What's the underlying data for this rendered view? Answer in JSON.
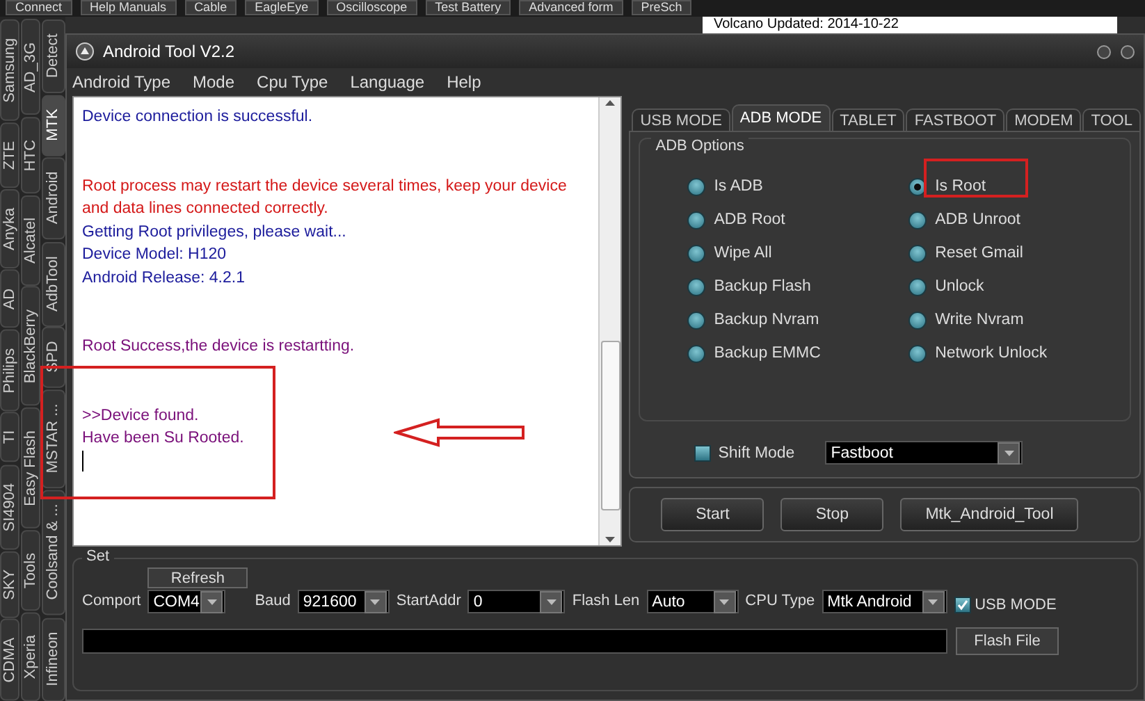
{
  "top_toolbar": {
    "buttons": [
      "Connect",
      "Help Manuals",
      "Cable",
      "EagleEye",
      "Oscilloscope",
      "Test Battery",
      "Advanced form",
      "PreSch"
    ],
    "notice": "Volcano Updated: 2014-10-22"
  },
  "side_tabs": [
    {
      "tabs": [
        {
          "label": "Samsung",
          "selected": false
        },
        {
          "label": "ZTE",
          "selected": false
        },
        {
          "label": "Anyka",
          "selected": false
        },
        {
          "label": "AD",
          "selected": false
        },
        {
          "label": "Philips",
          "selected": false
        },
        {
          "label": "TI",
          "selected": false
        },
        {
          "label": "SI4904",
          "selected": false
        },
        {
          "label": "SKY",
          "selected": false
        },
        {
          "label": "CDMA",
          "selected": false
        }
      ]
    },
    {
      "tabs": [
        {
          "label": "AD_3G",
          "selected": false
        },
        {
          "label": "HTC",
          "selected": false
        },
        {
          "label": "Alcatel",
          "selected": false
        },
        {
          "label": "BlackBerry",
          "selected": false
        },
        {
          "label": "Easy Flash",
          "selected": false
        },
        {
          "label": "Tools",
          "selected": false
        },
        {
          "label": "Xperia",
          "selected": false
        }
      ]
    },
    {
      "tabs": [
        {
          "label": "Detect",
          "selected": false
        },
        {
          "label": "MTK",
          "selected": true
        },
        {
          "label": "Android",
          "selected": false
        },
        {
          "label": "AdbTool",
          "selected": false
        },
        {
          "label": "SPD",
          "selected": false
        },
        {
          "label": "MSTAR ...",
          "selected": false
        },
        {
          "label": "Coolsand & ...",
          "selected": false
        },
        {
          "label": "Infineon",
          "selected": false
        }
      ]
    }
  ],
  "window": {
    "title": "Android Tool V2.2"
  },
  "menu": [
    "Android Type",
    "Mode",
    "Cpu Type",
    "Language",
    "Help"
  ],
  "log": {
    "paragraphs": [
      {
        "lines": [
          {
            "kind": "info",
            "text": "Device connection is successful."
          }
        ]
      },
      {
        "lines": [
          {
            "kind": "warning",
            "text": " Root process may restart the device several times, keep your device and data lines connected correctly."
          },
          {
            "kind": "info",
            "text": "Getting Root privileges, please wait..."
          },
          {
            "kind": "info",
            "text": "Device Model: H120"
          },
          {
            "kind": "info",
            "text": "Android Release: 4.2.1"
          }
        ]
      },
      {
        "lines": [
          {
            "kind": "success",
            "text": "Root Success,the device is restartting."
          }
        ]
      },
      {
        "lines": [
          {
            "kind": "device",
            "text": ">>Device found."
          },
          {
            "kind": "device",
            "text": "Have been Su Rooted."
          }
        ]
      }
    ]
  },
  "mode_tabs": [
    {
      "label": "USB MODE",
      "selected": false
    },
    {
      "label": "ADB MODE",
      "selected": true
    },
    {
      "label": "TABLET",
      "selected": false
    },
    {
      "label": "FASTBOOT",
      "selected": false
    },
    {
      "label": "MODEM",
      "selected": false
    },
    {
      "label": "TOOL",
      "selected": false
    }
  ],
  "adb_options": {
    "title": "ADB Options",
    "options": [
      {
        "label": "Is ADB",
        "selected": false
      },
      {
        "label": "ADB Root",
        "selected": false
      },
      {
        "label": "Wipe All",
        "selected": false
      },
      {
        "label": "Backup Flash",
        "selected": false
      },
      {
        "label": "Backup Nvram",
        "selected": false
      },
      {
        "label": "Backup EMMC",
        "selected": false
      },
      {
        "label": "Is Root",
        "selected": true
      },
      {
        "label": "ADB Unroot",
        "selected": false
      },
      {
        "label": "Reset Gmail",
        "selected": false
      },
      {
        "label": "Unlock",
        "selected": false
      },
      {
        "label": "Write Nvram",
        "selected": false
      },
      {
        "label": "Network Unlock",
        "selected": false
      }
    ]
  },
  "shift_mode": {
    "label": "Shift Mode",
    "checked": false,
    "value": "Fastboot"
  },
  "actions": [
    "Start",
    "Stop",
    "Mtk_Android_Tool"
  ],
  "set": {
    "title": "Set",
    "refresh": "Refresh",
    "fields": [
      {
        "label": "Comport",
        "value": "COM4"
      },
      {
        "label": "Baud",
        "value": "921600"
      },
      {
        "label": "StartAddr",
        "value": "0"
      },
      {
        "label": "Flash Len",
        "value": "Auto"
      },
      {
        "label": "CPU Type",
        "value": "Mtk Android"
      }
    ],
    "usb_mode": {
      "label": "USB MODE",
      "checked": true
    },
    "flash_file": "Flash File"
  }
}
